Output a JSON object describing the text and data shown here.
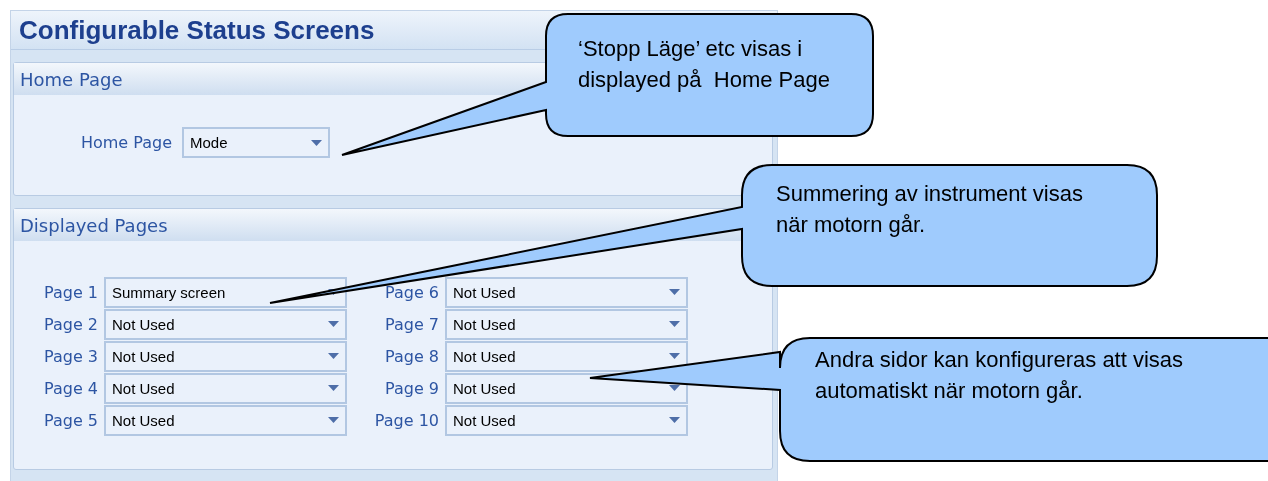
{
  "title": "Configurable Status Screens",
  "home_page": {
    "header": "Home Page",
    "label": "Home Page",
    "value": "Mode"
  },
  "displayed_pages": {
    "header": "Displayed Pages",
    "pages": [
      {
        "label": "Page 1",
        "value": "Summary screen"
      },
      {
        "label": "Page 2",
        "value": "Not Used"
      },
      {
        "label": "Page 3",
        "value": "Not Used"
      },
      {
        "label": "Page 4",
        "value": "Not Used"
      },
      {
        "label": "Page 5",
        "value": "Not Used"
      },
      {
        "label": "Page 6",
        "value": "Not Used"
      },
      {
        "label": "Page 7",
        "value": "Not Used"
      },
      {
        "label": "Page 8",
        "value": "Not Used"
      },
      {
        "label": "Page 9",
        "value": "Not Used"
      },
      {
        "label": "Page 10",
        "value": "Not Used"
      }
    ]
  },
  "callouts": [
    {
      "text": "‘Stopp Läge’ etc visas i displayed på  Home Page"
    },
    {
      "text": "Summering av instrument visas när motorn går."
    },
    {
      "text": "Andra sidor kan konfigureras att visas automatiskt när motorn går."
    }
  ]
}
